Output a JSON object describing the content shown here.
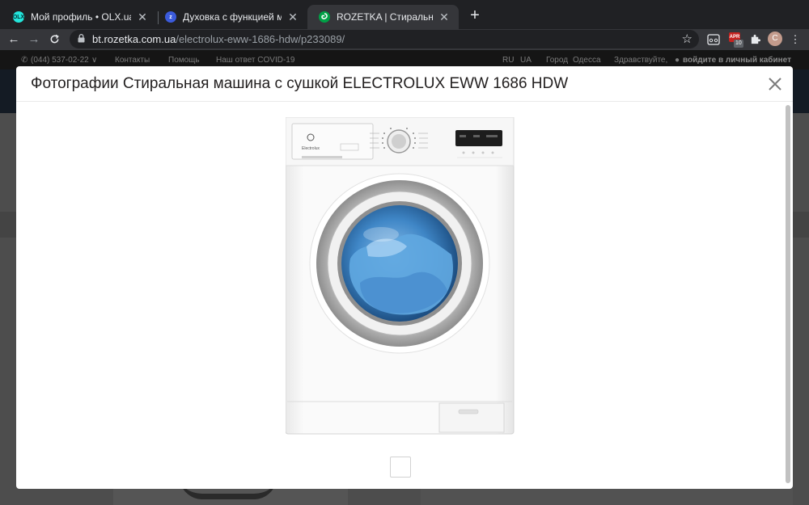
{
  "browser": {
    "tabs": [
      {
        "title": "Мой профиль • OLX.ua",
        "favicon": "olx-favicon",
        "favicon_text": "OLX",
        "favicon_color": "#23e5db"
      },
      {
        "title": "Духовка с функцией микрово",
        "favicon": "zakaz-favicon",
        "favicon_text": "z",
        "favicon_color": "#3b5bdb"
      },
      {
        "title": "ROZETKA | Стиральная маши",
        "favicon": "rozetka-favicon",
        "favicon_text": "",
        "favicon_color": "#00a046"
      }
    ],
    "url_host": "bt.rozetka.com.ua",
    "url_path": "/electrolux-eww-1686-hdw/p233089/",
    "extension_badge": "10",
    "extension_label": "APR",
    "profile_initial": "C"
  },
  "site_topbar": {
    "phone": "(044) 537-02-22",
    "contacts": "Контакты",
    "help": "Помощь",
    "covid": "Наш ответ COVID-19",
    "lang_ru": "RU",
    "lang_ua": "UA",
    "city_label": "Город",
    "city": "Одесса",
    "greeting": "Здравствуйте,",
    "login": "войдите в личный кабинет"
  },
  "modal": {
    "title": "Фотографии Стиральная машина с сушкой ELECTROLUX EWW 1686 HDW",
    "photo_brand": "Electrolux"
  }
}
